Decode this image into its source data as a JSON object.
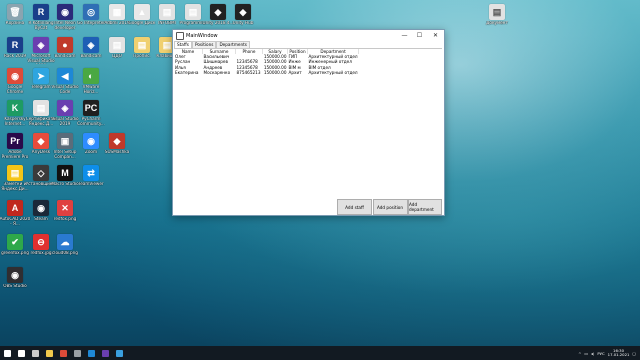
{
  "desktop": {
    "icons": [
      {
        "label": "Корзина",
        "glyph": "🗑",
        "color": "#8aa4b0",
        "col": 0,
        "row": 0
      },
      {
        "label": "R\nKotlinlang ByCat",
        "glyph": "R",
        "color": "#1a3f8a",
        "col": 1,
        "row": 0
      },
      {
        "label": "Intel Neon developer",
        "glyph": "◉",
        "color": "#2b2b7a",
        "col": 2,
        "row": 0
      },
      {
        "label": "Go Intepreter",
        "glyph": "◎",
        "color": "#2f6fb5",
        "col": 3,
        "row": 0
      },
      {
        "label": "Adbmi 2019",
        "glyph": "▦",
        "color": "#e8e8e8",
        "col": 4,
        "row": 0
      },
      {
        "label": "Google Диск",
        "glyph": "▲",
        "color": "#e8e8e8",
        "col": 5,
        "row": 0
      },
      {
        "label": "INFOBMI",
        "glyph": "▤",
        "color": "#e2e2e2",
        "col": 6,
        "row": 0
      },
      {
        "label": "Programmi...",
        "glyph": "▤",
        "color": "#e2e2e2",
        "col": 7,
        "row": 0
      },
      {
        "label": "Unity 2018.4...",
        "glyph": "◆",
        "color": "#222",
        "col": 8,
        "row": 0
      },
      {
        "label": "Unity Hub",
        "glyph": "◆",
        "color": "#222",
        "col": 9,
        "row": 0
      },
      {
        "label": "Rack 2019",
        "glyph": "R",
        "color": "#1a3f8a",
        "col": 0,
        "row": 1
      },
      {
        "label": "Microsoft Visual Studio 2019",
        "glyph": "◈",
        "color": "#6a3fb0",
        "col": 1,
        "row": 1
      },
      {
        "label": "Bandicam",
        "glyph": "●",
        "color": "#c0392b",
        "col": 2,
        "row": 1
      },
      {
        "label": "Bandicam",
        "glyph": "◈",
        "color": "#1e5fb5",
        "col": 3,
        "row": 1
      },
      {
        "label": "ЦДО",
        "glyph": "▤",
        "color": "#e2e2e2",
        "col": 4,
        "row": 1
      },
      {
        "label": "Пропис.",
        "glyph": "▤",
        "color": "#f0d070",
        "col": 5,
        "row": 1
      },
      {
        "label": "Клавиш...",
        "glyph": "▤",
        "color": "#f0d070",
        "col": 6,
        "row": 1
      },
      {
        "label": "Google Chrome",
        "glyph": "◉",
        "color": "#dd4b39",
        "col": 0,
        "row": 2
      },
      {
        "label": "Telegram",
        "glyph": "➤",
        "color": "#2ea5e0",
        "col": 1,
        "row": 2
      },
      {
        "label": "Visual Studio Code",
        "glyph": "◀",
        "color": "#1e88d6",
        "col": 2,
        "row": 2
      },
      {
        "label": "VMware Horiz...",
        "glyph": "◐",
        "color": "#4aa843",
        "col": 3,
        "row": 2
      },
      {
        "label": "Kaspersky Internet...",
        "glyph": "K",
        "color": "#1e9b63",
        "col": 0,
        "row": 3
      },
      {
        "label": "Сертификаты Яндекс.Д...",
        "glyph": "▤",
        "color": "#e2e2e2",
        "col": 1,
        "row": 3
      },
      {
        "label": "Visual Studio 2019",
        "glyph": "◈",
        "color": "#6a3fb0",
        "col": 2,
        "row": 3
      },
      {
        "label": "PyCharm Community...",
        "glyph": "PC",
        "color": "#1f1f1f",
        "col": 3,
        "row": 3
      },
      {
        "label": "Adobe Premiere Pro",
        "glyph": "Pr",
        "color": "#2a0a4a",
        "col": 0,
        "row": 4
      },
      {
        "label": "AnyDesk",
        "glyph": "◆",
        "color": "#e74c3c",
        "col": 1,
        "row": 4
      },
      {
        "label": "Intel Setup Compan...",
        "glyph": "▣",
        "color": "#5a6c7a",
        "col": 2,
        "row": 4
      },
      {
        "label": "Zoom",
        "glyph": "◉",
        "color": "#2d8cff",
        "col": 3,
        "row": 4
      },
      {
        "label": "SUSMashka",
        "glyph": "◆",
        "color": "#c0392b",
        "col": 4,
        "row": 4
      },
      {
        "label": "Заметки и Яндекс.Ди...",
        "glyph": "▤",
        "color": "#f5c518",
        "col": 0,
        "row": 5
      },
      {
        "label": "Установщик...",
        "glyph": "◇",
        "color": "#3a3a3a",
        "col": 1,
        "row": 5
      },
      {
        "label": "Macro Studio",
        "glyph": "M",
        "color": "#111",
        "col": 2,
        "row": 5
      },
      {
        "label": "TeamViewer",
        "glyph": "⇄",
        "color": "#0e8ee9",
        "col": 3,
        "row": 5
      },
      {
        "label": "AutoCAD 2020 - Я...",
        "glyph": "A",
        "color": "#c0281e",
        "col": 0,
        "row": 6
      },
      {
        "label": "Steam",
        "glyph": "◉",
        "color": "#1b2838",
        "col": 1,
        "row": 6
      },
      {
        "label": "redfox.png",
        "glyph": "✕",
        "color": "#e04040",
        "col": 2,
        "row": 6
      },
      {
        "label": "greenfox.png",
        "glyph": "✔",
        "color": "#2ea84a",
        "col": 0,
        "row": 7
      },
      {
        "label": "redfox.jpg",
        "glyph": "⊖",
        "color": "#e03030",
        "col": 1,
        "row": 7
      },
      {
        "label": "cloud08.png",
        "glyph": "☁",
        "color": "#2a7ad0",
        "col": 2,
        "row": 7
      },
      {
        "label": "OBS Studio",
        "glyph": "◉",
        "color": "#302e31",
        "col": 0,
        "row": 8
      }
    ],
    "right_icon": {
      "label": "Документ",
      "glyph": "▤",
      "color": "#e2e2e2"
    }
  },
  "window": {
    "title": "MainWindow",
    "tabs": [
      {
        "label": "Staffs",
        "active": true
      },
      {
        "label": "Positions",
        "active": false
      },
      {
        "label": "Departments",
        "active": false
      }
    ],
    "columns": [
      "Name",
      "Surname",
      "Phone",
      "Salary",
      "Position",
      "Department"
    ],
    "rows": [
      [
        "Олег",
        "Васильевич",
        "",
        "150000.00",
        "ГИП",
        "Архитектурный отдел"
      ],
      [
        "Руслан",
        "Шишмарев",
        "12345678",
        "150000.00",
        "Инже",
        "Инженерный отдел"
      ],
      [
        "Илья",
        "Андреев",
        "12345678",
        "150000.00",
        "BIM м",
        "BIM отдел"
      ],
      [
        "Екатерина",
        "Москаренко",
        "875465213",
        "150000.00",
        "Архит",
        "Архитектурный отдел"
      ]
    ],
    "buttons": {
      "add_staff": "Add staff",
      "add_position": "Add position",
      "add_department": "Add department"
    }
  },
  "taskbar": {
    "lang": "РУС",
    "time": "16:30",
    "date": "17.01.2021",
    "items": [
      {
        "name": "start",
        "color": "#ffffff"
      },
      {
        "name": "search",
        "color": "#ffffff"
      },
      {
        "name": "task-view",
        "color": "#cccccc"
      },
      {
        "name": "explorer",
        "color": "#f2c94c"
      },
      {
        "name": "chrome",
        "color": "#dd4b39"
      },
      {
        "name": "settings",
        "color": "#9aa0a6"
      },
      {
        "name": "vscode",
        "color": "#1e88d6"
      },
      {
        "name": "visual-studio",
        "color": "#6a3fb0"
      },
      {
        "name": "app-window",
        "color": "#3aa0e0"
      }
    ]
  }
}
